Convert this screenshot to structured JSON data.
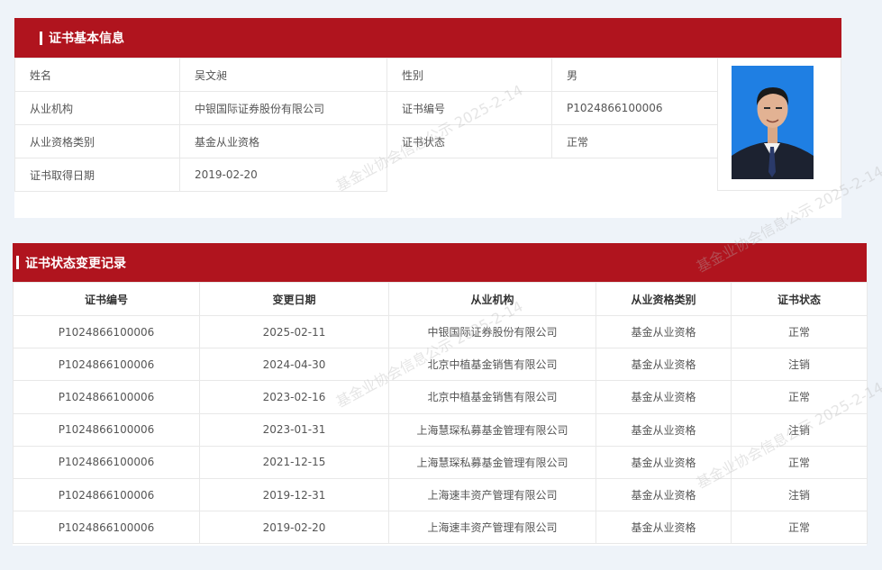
{
  "basic_info": {
    "section_title": "证书基本信息",
    "rows": [
      {
        "label1": "姓名",
        "value1": "吴文昶",
        "label2": "性别",
        "value2": "男"
      },
      {
        "label1": "从业机构",
        "value1": "中银国际证券股份有限公司",
        "label2": "证书编号",
        "value2": "P1024866100006"
      },
      {
        "label1": "从业资格类别",
        "value1": "基金从业资格",
        "label2": "证书状态",
        "value2": "正常"
      },
      {
        "label1": "证书取得日期",
        "value1": "2019-02-20"
      }
    ]
  },
  "records": {
    "section_title": "证书状态变更记录",
    "headers": [
      "证书编号",
      "变更日期",
      "从业机构",
      "从业资格类别",
      "证书状态"
    ],
    "rows": [
      [
        "P1024866100006",
        "2025-02-11",
        "中银国际证券股份有限公司",
        "基金从业资格",
        "正常"
      ],
      [
        "P1024866100006",
        "2024-04-30",
        "北京中植基金销售有限公司",
        "基金从业资格",
        "注销"
      ],
      [
        "P1024866100006",
        "2023-02-16",
        "北京中植基金销售有限公司",
        "基金从业资格",
        "正常"
      ],
      [
        "P1024866100006",
        "2023-01-31",
        "上海慧琛私募基金管理有限公司",
        "基金从业资格",
        "注销"
      ],
      [
        "P1024866100006",
        "2021-12-15",
        "上海慧琛私募基金管理有限公司",
        "基金从业资格",
        "正常"
      ],
      [
        "P1024866100006",
        "2019-12-31",
        "上海速丰资产管理有限公司",
        "基金从业资格",
        "注销"
      ],
      [
        "P1024866100006",
        "2019-02-20",
        "上海速丰资产管理有限公司",
        "基金从业资格",
        "正常"
      ]
    ]
  },
  "watermark": {
    "text": "基金业协会信息公示 2025-2-14"
  },
  "colors": {
    "header_red": "#b0141e",
    "background": "#eef3f9"
  }
}
